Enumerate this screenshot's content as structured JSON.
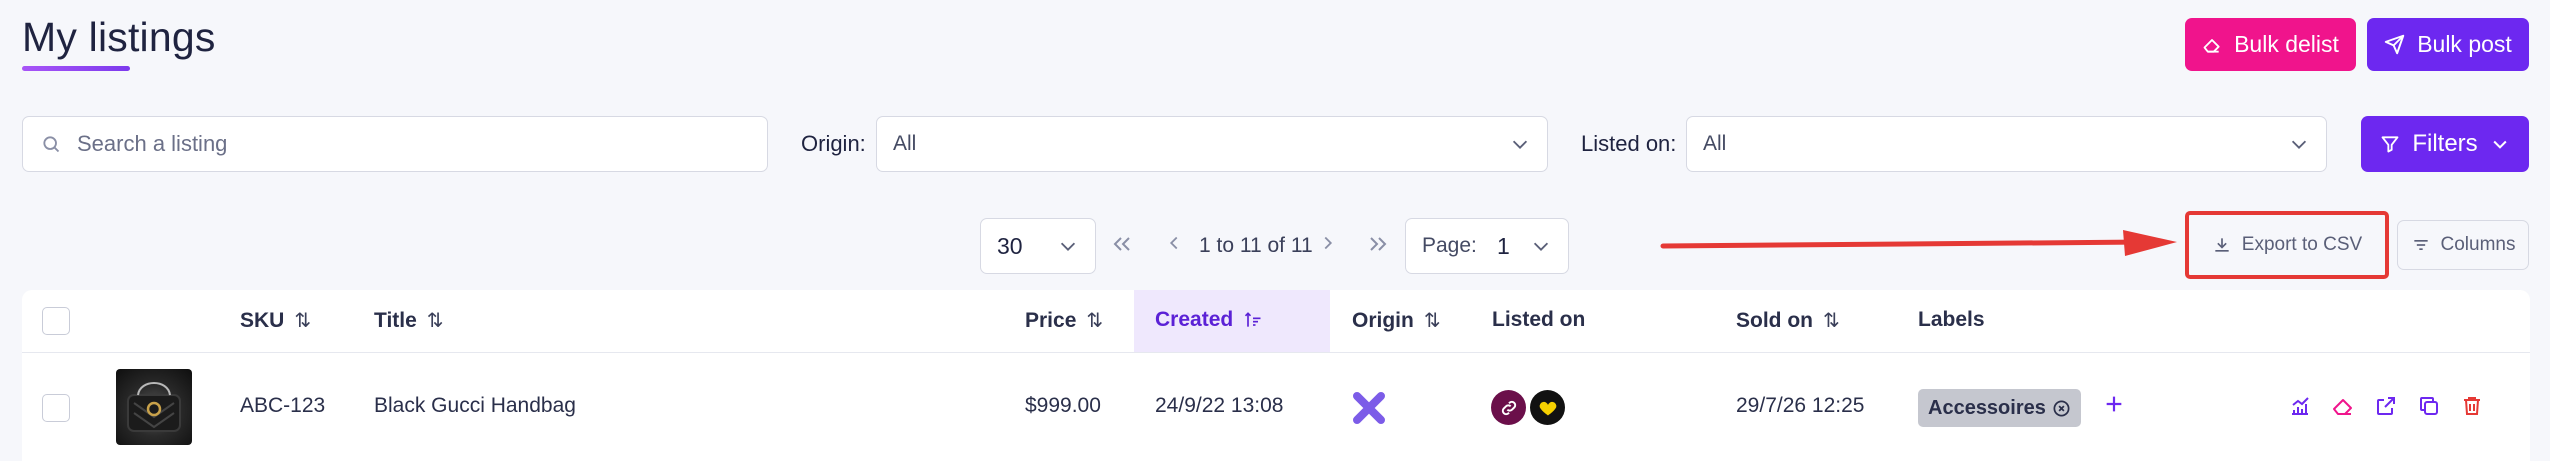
{
  "header": {
    "title": "My listings",
    "bulk_delist_label": "Bulk delist",
    "bulk_post_label": "Bulk post"
  },
  "filters": {
    "search_placeholder": "Search a listing",
    "origin_label": "Origin:",
    "origin_value": "All",
    "listed_on_label": "Listed on:",
    "listed_on_value": "All",
    "filters_label": "Filters"
  },
  "pagination": {
    "page_size": "30",
    "range_text": "1 to 11 of 11",
    "page_label": "Page:",
    "page_value": "1"
  },
  "toolbar": {
    "export_label": "Export to CSV",
    "columns_label": "Columns"
  },
  "table": {
    "columns": {
      "sku": "SKU",
      "title": "Title",
      "price": "Price",
      "created": "Created",
      "origin": "Origin",
      "listed_on": "Listed on",
      "sold_on": "Sold on",
      "labels": "Labels"
    },
    "rows": [
      {
        "sku": "ABC-123",
        "title": "Black Gucci Handbag",
        "price": "$999.00",
        "created": "24/9/22 13:08",
        "sold_on": "29/7/26 12:25",
        "label": "Accessoires"
      }
    ]
  },
  "colors": {
    "primary": "#6d28f0",
    "delist": "#f0148c",
    "highlight": "#e53935",
    "badge": "#c5c7cf"
  },
  "icons": [
    "eraser-icon",
    "send-icon",
    "search-icon",
    "chevron-down-icon",
    "funnel-icon",
    "double-chevron-left-icon",
    "chevron-left-icon",
    "chevron-right-icon",
    "double-chevron-right-icon",
    "download-icon",
    "columns-filter-icon",
    "sort-icon",
    "origin-x-icon",
    "link-icon",
    "heart-icon",
    "close-circle-icon",
    "plus-icon",
    "analytics-icon",
    "external-link-icon",
    "duplicate-icon",
    "trash-icon"
  ]
}
